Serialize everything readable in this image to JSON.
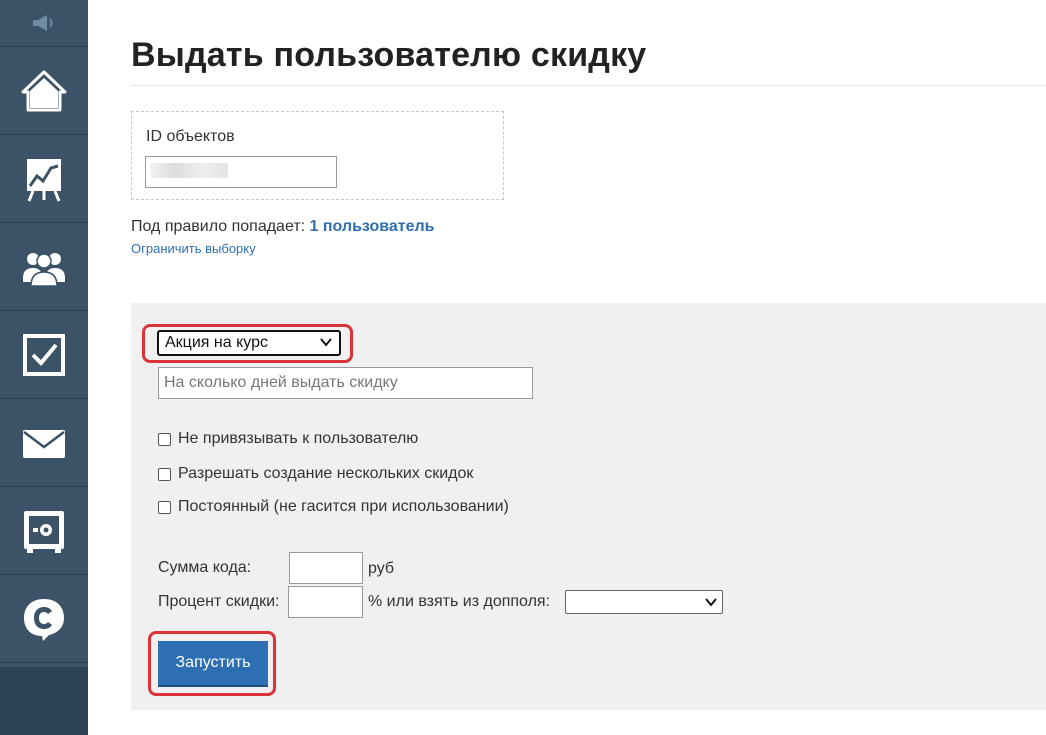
{
  "sidebar": {
    "items": [
      {
        "icon": "megaphone-icon"
      },
      {
        "icon": "home-icon"
      },
      {
        "icon": "chart-board-icon"
      },
      {
        "icon": "users-icon"
      },
      {
        "icon": "checkbox-icon"
      },
      {
        "icon": "mail-icon"
      },
      {
        "icon": "safe-icon"
      },
      {
        "icon": "chat-logo-icon"
      }
    ],
    "bg_color": "#3b5267"
  },
  "page": {
    "title": "Выдать пользователю скидку"
  },
  "ids": {
    "label": "ID объектов",
    "value": ""
  },
  "rule": {
    "prefix": "Под правило попадает:",
    "count_link": "1 пользователь",
    "limit_link": "Ограничить выборку"
  },
  "form": {
    "type_select": "Акция на курс",
    "days_placeholder": "На сколько дней выдать скидку",
    "checkboxes": [
      {
        "label": "Не привязывать к пользователю",
        "checked": false
      },
      {
        "label": "Разрешать создание нескольких скидок",
        "checked": false
      },
      {
        "label": "Постоянный (не гасится при использовании)",
        "checked": false
      }
    ],
    "amount_label": "Сумма кода:",
    "amount_unit": "руб",
    "percent_label": "Процент скидки:",
    "percent_suffix": "% или взять из допполя:",
    "extra_field_select": "",
    "submit_label": "Запустить"
  },
  "colors": {
    "accent": "#2d6fb0",
    "highlight": "#d9343a",
    "panel": "#f0f0f0"
  }
}
